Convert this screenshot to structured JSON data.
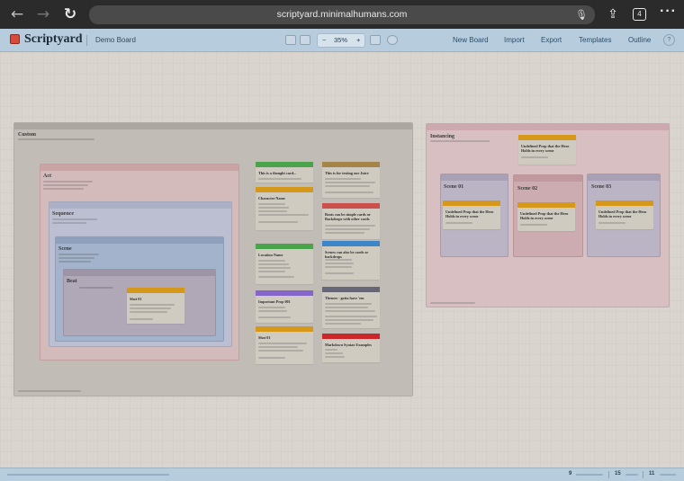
{
  "browser": {
    "url": "scriptyard.minimalhumans.com",
    "tab_count": "4",
    "back_icon": "arrow-left-icon",
    "forward_icon": "arrow-right-icon",
    "reload_icon": "reload-icon",
    "mic_icon": "microphone-icon",
    "share_icon": "share-icon",
    "more_icon": "ellipsis-icon"
  },
  "app": {
    "brand": "Scriptyard",
    "board_name": "Demo Board",
    "zoom": "35%",
    "zoom_minus": "−",
    "zoom_plus": "+",
    "menu": [
      "New Board",
      "Import",
      "Export",
      "Templates",
      "Outline"
    ],
    "help": "?",
    "accent": "#d84b3b"
  },
  "canvas": {
    "custom_container": {
      "title": "Custom"
    },
    "act": {
      "title": "Act"
    },
    "sequence": {
      "title": "Sequence"
    },
    "scene": {
      "title": "Scene"
    },
    "beat": {
      "title": "Beat"
    },
    "shot_card": {
      "title": "Shot 01"
    },
    "col1": [
      {
        "title": "This is a thought card...",
        "color": "#4caf50"
      },
      {
        "title": "Character Name",
        "color": "#e5a21b"
      },
      {
        "title": "Location Name",
        "color": "#4caf50"
      },
      {
        "title": "Important Prop 001",
        "color": "#8e6bd8"
      },
      {
        "title": "Shot 01",
        "color": "#e5a21b"
      }
    ],
    "col2": [
      {
        "title": "This is for testing our Juice",
        "color": "#b08e4a"
      },
      {
        "title": "Beats can be simple cards or Backdrops with other cards",
        "color": "#d9534f"
      },
      {
        "title": "Scenes can also be cards or backdrops",
        "color": "#3f8fd8"
      },
      {
        "title": "Themes - gotta have 'em",
        "color": "#6c6c7d"
      },
      {
        "title": "Markdown Syntax Examples",
        "color": "#d9262b"
      }
    ],
    "instancing_container": {
      "title": "Instancing"
    },
    "instanced_card": {
      "title": "Undefined Prop that the Hero Holds in every scene"
    },
    "scenes": [
      {
        "title": "Scene 01",
        "card": "Undefined Prop that the Hero Holds in every scene"
      },
      {
        "title": "Scene 02",
        "card": "Undefined Prop that the Hero Holds in every scene"
      },
      {
        "title": "Scene 03",
        "card": "Undefined Prop that the Hero Holds in every scene"
      }
    ]
  },
  "status": {
    "count1": "9",
    "count2": "15",
    "count3": "11"
  }
}
